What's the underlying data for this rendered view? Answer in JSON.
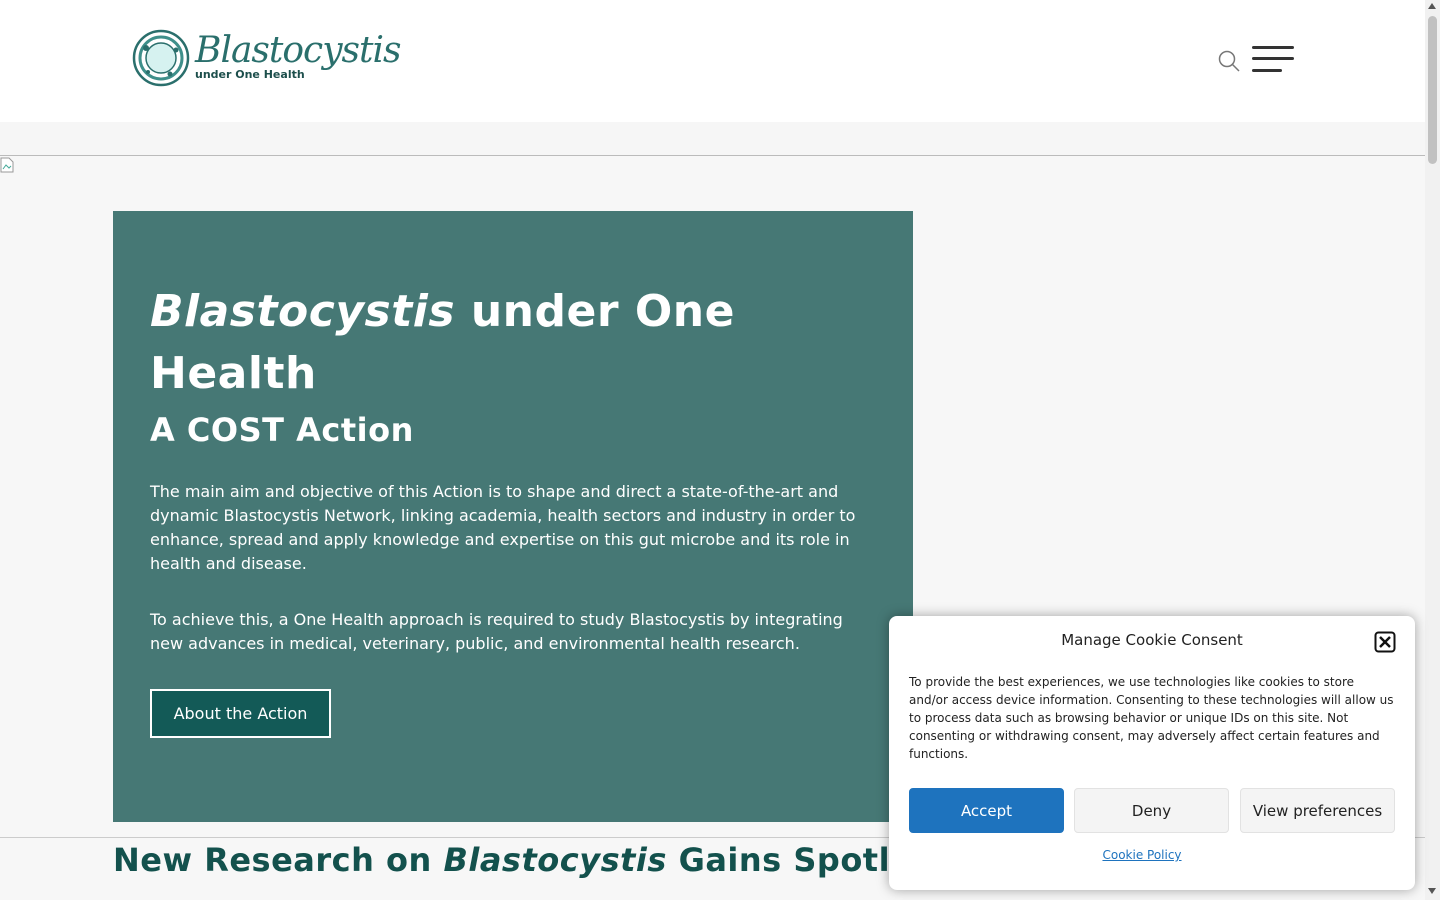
{
  "header": {
    "logo_name": "Blastocystis",
    "logo_tagline": "under One Health"
  },
  "hero": {
    "title_italic": "Blastocystis",
    "title_rest": " under One Health",
    "subtitle": "A COST Action",
    "paragraph1": "The main aim and objective of this Action is to shape and direct a state-of-the-art and dynamic Blastocystis Network, linking academia, health sectors and industry in order to enhance, spread and apply knowledge and expertise on this gut microbe and its role in health and disease.",
    "paragraph2": "To achieve this, a One Health approach is required to study Blastocystis by integrating new advances in medical, veterinary, public, and environmental health research.",
    "button_label": "About the Action"
  },
  "news": {
    "title_pre": "New Research on ",
    "title_italic": "Blastocystis",
    "title_post": " Gains Spotlig"
  },
  "cookie_banner": {
    "title": "Manage Cookie Consent",
    "text": "To provide the best experiences, we use technologies like cookies to store and/or access device information. Consenting to these technologies will allow us to process data such as browsing behavior or unique IDs on this site. Not consenting or withdrawing consent, may adversely affect certain features and functions.",
    "accept_label": "Accept",
    "deny_label": "Deny",
    "preferences_label": "View preferences",
    "policy_link": "Cookie Policy"
  },
  "colors": {
    "brand_teal": "#467875",
    "dark_teal": "#135a57",
    "accept_blue": "#1e73be"
  },
  "icons": [
    "logo-cell-icon",
    "search-icon",
    "hamburger-menu-icon",
    "close-icon",
    "broken-image-icon"
  ]
}
